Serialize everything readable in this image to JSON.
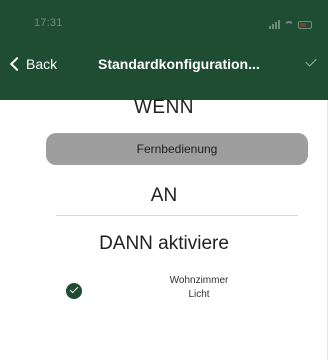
{
  "status_bar": {
    "time": "17:31"
  },
  "nav": {
    "back_label": "Back",
    "title": "Standardkonfiguration..."
  },
  "wenn": {
    "heading": "WENN",
    "trigger": "Fernbedienung"
  },
  "an": {
    "heading": "AN"
  },
  "dann": {
    "heading": "DANN aktiviere",
    "action": {
      "room": "Wohnzimmer",
      "device": "Licht",
      "checked": true
    }
  },
  "colors": {
    "header_green": "#1f4d31",
    "pill_gray": "#9e9e9e"
  }
}
